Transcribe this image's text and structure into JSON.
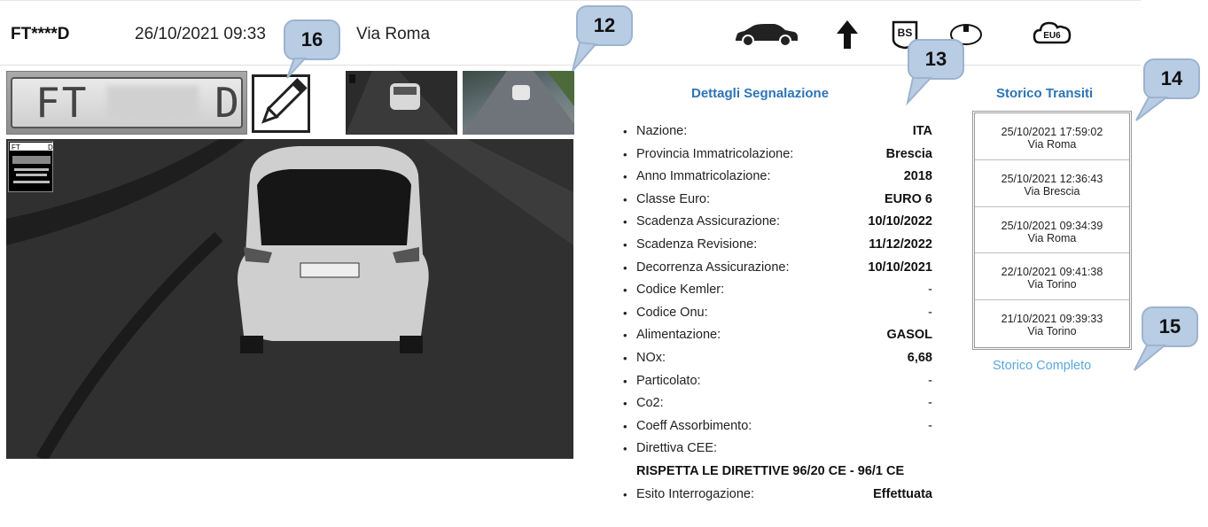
{
  "header": {
    "plate": "FT****D",
    "datetime": "26/10/2021 09:33",
    "location": "Via Roma",
    "icons": [
      "car-icon",
      "arrow-up-icon",
      "province-badge-icon",
      "vehicle-class-icon",
      "euro6-icon"
    ],
    "province_badge": "BS",
    "euro_badge": "EU6"
  },
  "plate_crop": {
    "left": "FT",
    "right": "D"
  },
  "overlay": {
    "plate": "FT",
    "suffix": "D"
  },
  "callouts": {
    "c16": "16",
    "c12": "12",
    "c13": "13",
    "c14": "14",
    "c15": "15"
  },
  "details": {
    "title": "Dettagli Segnalazione",
    "items": [
      {
        "label": "Nazione:",
        "value": "ITA"
      },
      {
        "label": "Provincia Immatricolazione:",
        "value": "Brescia"
      },
      {
        "label": "Anno Immatricolazione:",
        "value": "2018"
      },
      {
        "label": "Classe Euro:",
        "value": "EURO 6"
      },
      {
        "label": "Scadenza Assicurazione:",
        "value": "10/10/2022"
      },
      {
        "label": "Scadenza Revisione:",
        "value": "11/12/2022"
      },
      {
        "label": "Decorrenza Assicurazione:",
        "value": "10/10/2021"
      },
      {
        "label": "Codice Kemler:",
        "value": "-"
      },
      {
        "label": "Codice Onu:",
        "value": "-"
      },
      {
        "label": "Alimentazione:",
        "value": "GASOL"
      },
      {
        "label": "NOx:",
        "value": "6,68"
      },
      {
        "label": "Particolato:",
        "value": "-"
      },
      {
        "label": "Co2:",
        "value": "-"
      },
      {
        "label": "Coeff Assorbimento:",
        "value": "-"
      },
      {
        "label": "Direttiva CEE:",
        "value": "RISPETTA LE DIRETTIVE 96/20 CE - 96/1 CE"
      },
      {
        "label": "Esito Interrogazione:",
        "value": "Effettuata"
      }
    ]
  },
  "storico": {
    "title": "Storico Transiti",
    "rows": [
      {
        "datetime": "25/10/2021 17:59:02",
        "location": "Via Roma"
      },
      {
        "datetime": "25/10/2021 12:36:43",
        "location": "Via Brescia"
      },
      {
        "datetime": "25/10/2021 09:34:39",
        "location": "Via Roma"
      },
      {
        "datetime": "22/10/2021 09:41:38",
        "location": "Via Torino"
      },
      {
        "datetime": "21/10/2021 09:39:33",
        "location": "Via Torino"
      }
    ],
    "link": "Storico Completo"
  }
}
